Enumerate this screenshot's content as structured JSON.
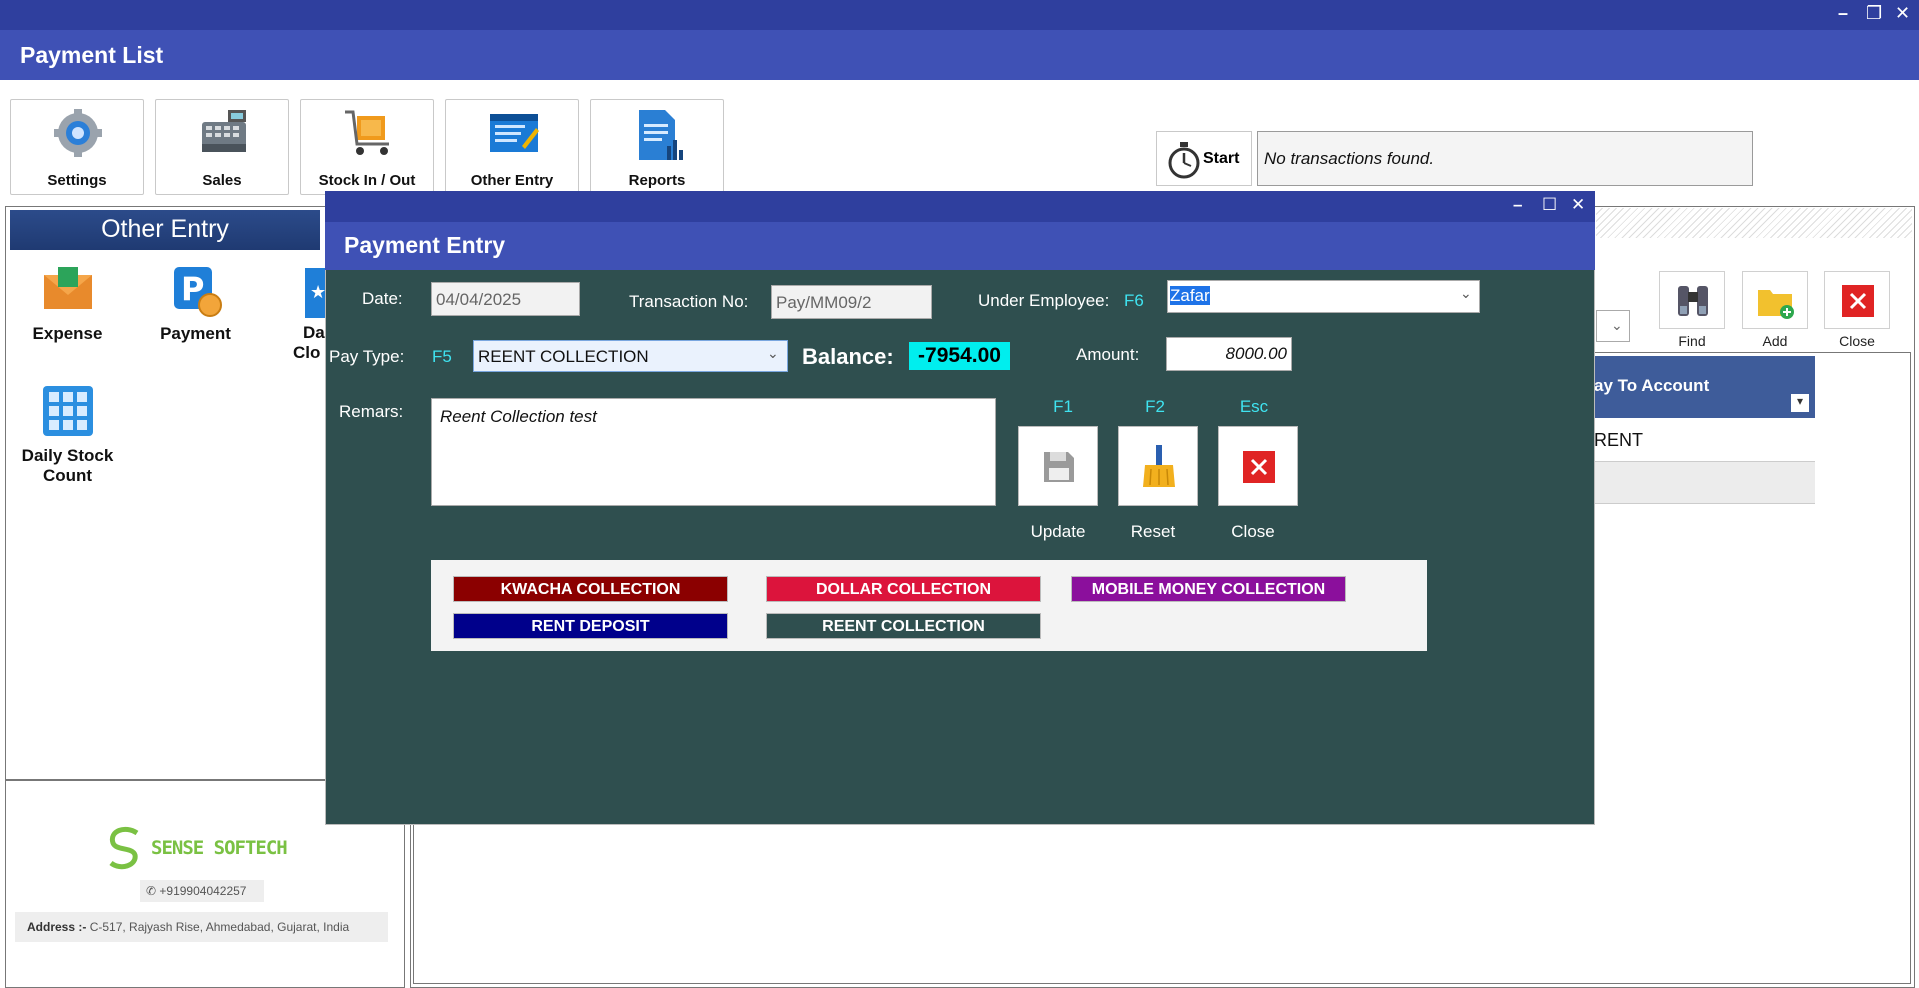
{
  "window": {
    "title": "Payment List",
    "controls": [
      "–",
      "❐",
      "✕"
    ]
  },
  "toolbar": [
    {
      "label": "Settings",
      "icon": "gear-icon"
    },
    {
      "label": "Sales",
      "icon": "cash-register-icon"
    },
    {
      "label": "Stock In / Out",
      "icon": "cart-icon"
    },
    {
      "label": "Other Entry",
      "icon": "edit-form-icon"
    },
    {
      "label": "Reports",
      "icon": "report-icon"
    }
  ],
  "timer": {
    "label": "Start",
    "status": "No transactions found."
  },
  "left_panel": {
    "header": "Other Entry",
    "items": [
      "Expense",
      "Payment",
      "Da",
      "Clo",
      "Daily Stock Count"
    ]
  },
  "company": {
    "name": "SENSE SOFTECH",
    "phone": "+919904042257",
    "address_label": "Address :-",
    "address": "C-517, Rajyash Rise, Ahmedabad, Gujarat, India"
  },
  "right_panel": {
    "buttons": [
      {
        "label": "Find",
        "icon": "binoculars-icon"
      },
      {
        "label": "Add",
        "icon": "add-folder-icon"
      },
      {
        "label": "Close",
        "icon": "close-icon"
      }
    ],
    "grid_header": "ay To Account",
    "grid_rows": [
      "RENT"
    ]
  },
  "dialog": {
    "title": "Payment Entry",
    "date_label": "Date:",
    "date_value": "04/04/2025",
    "txn_label": "Transaction No:",
    "txn_value": "Pay/MM09/2",
    "employee_label": "Under Employee:",
    "employee_key": "F6",
    "employee_value": "Zafar",
    "paytype_label": "Pay Type:",
    "paytype_key": "F5",
    "paytype_value": "REENT COLLECTION",
    "balance_label": "Balance:",
    "balance_value": "-7954.00",
    "amount_label": "Amount:",
    "amount_value": "8000.00",
    "remarks_label": "Remars:",
    "remarks_value": "Reent Collection test",
    "actions": [
      {
        "key": "F1",
        "label": "Update",
        "icon": "save-icon"
      },
      {
        "key": "F2",
        "label": "Reset",
        "icon": "broom-icon"
      },
      {
        "key": "Esc",
        "label": "Close",
        "icon": "close-icon"
      }
    ],
    "quick_buttons": [
      {
        "label": "KWACHA COLLECTION",
        "color": "#8b0000"
      },
      {
        "label": "DOLLAR COLLECTION",
        "color": "#dc143c"
      },
      {
        "label": "MOBILE MONEY  COLLECTION",
        "color": "#8b0f9c"
      },
      {
        "label": "RENT DEPOSIT",
        "color": "#00008b"
      },
      {
        "label": "REENT COLLECTION",
        "color": "#2f4f4f"
      }
    ]
  }
}
